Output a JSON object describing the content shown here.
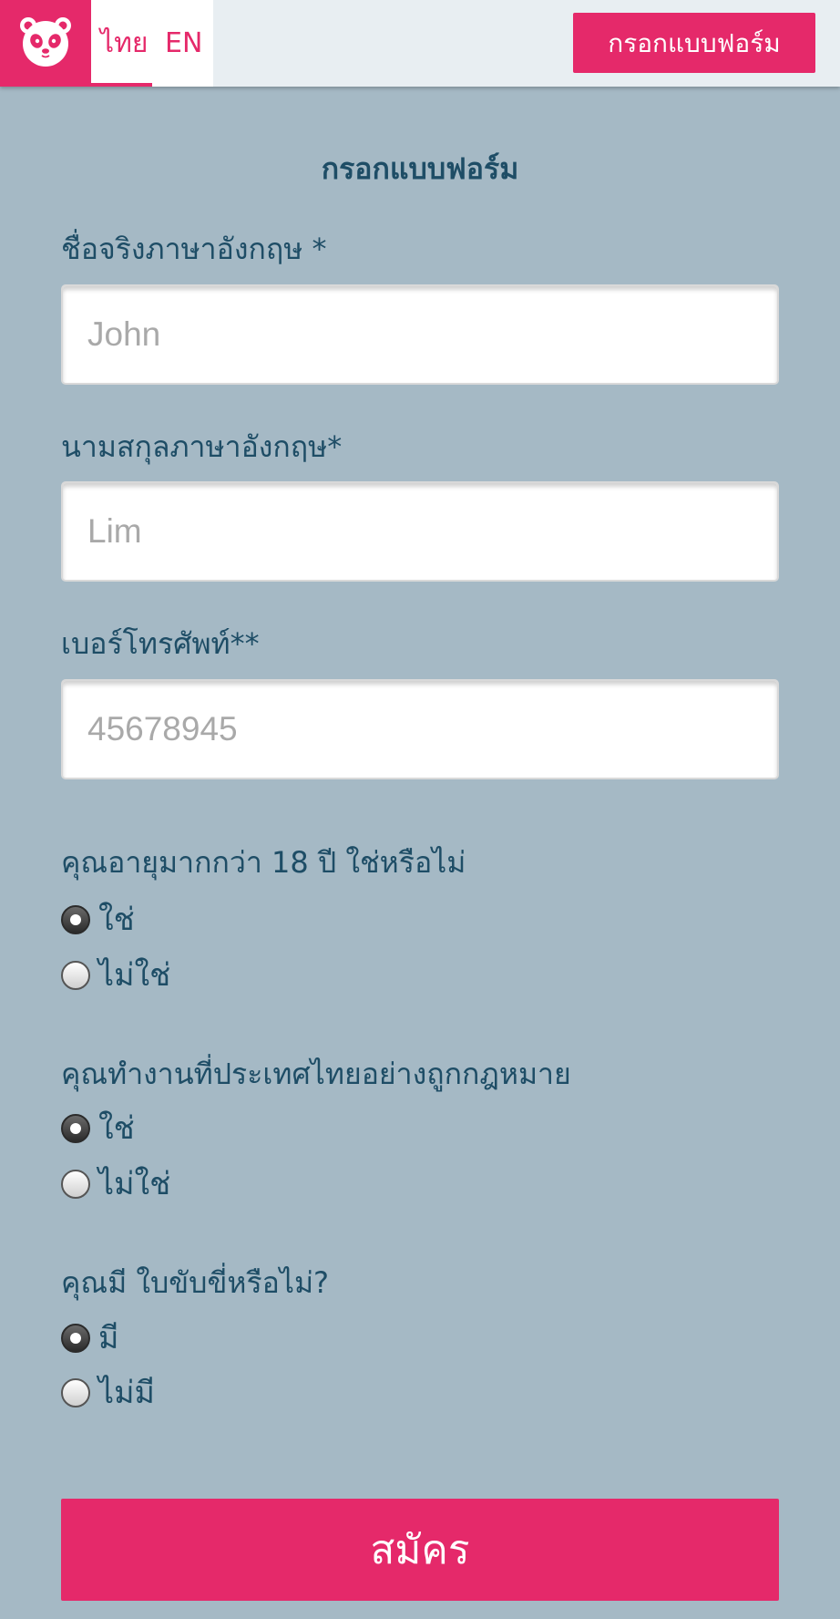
{
  "header": {
    "lang_th": "ไทย",
    "lang_en": "EN",
    "cta_label": "กรอกแบบฟอร์ม",
    "brand_color": "#e5296a"
  },
  "form": {
    "title": "กรอกแบบฟอร์ม",
    "first_name": {
      "label": "ชื่อจริงภาษาอังกฤษ *",
      "placeholder": "John",
      "value": ""
    },
    "last_name": {
      "label": "นามสกุลภาษาอังกฤษ*",
      "placeholder": "Lim",
      "value": ""
    },
    "phone": {
      "label": "เบอร์โทรศัพท์**",
      "placeholder": "45678945",
      "value": ""
    },
    "age_question": {
      "label": "คุณอายุมากกว่า 18 ปี  ใช่หรือไม่",
      "options": [
        {
          "label": "ใช่",
          "checked": true
        },
        {
          "label": "ไม่ใช่",
          "checked": false
        }
      ]
    },
    "work_question": {
      "label": "คุณทำงานที่ประเทศไทยอย่างถูกกฎหมาย",
      "options": [
        {
          "label": "ใช่",
          "checked": true
        },
        {
          "label": "ไม่ใช่",
          "checked": false
        }
      ]
    },
    "license_question": {
      "label": "คุณมี ใบขับขี่หรือไม่?",
      "options": [
        {
          "label": "มี",
          "checked": true
        },
        {
          "label": "ไม่มี",
          "checked": false
        }
      ]
    },
    "submit_label": "สมัคร"
  }
}
